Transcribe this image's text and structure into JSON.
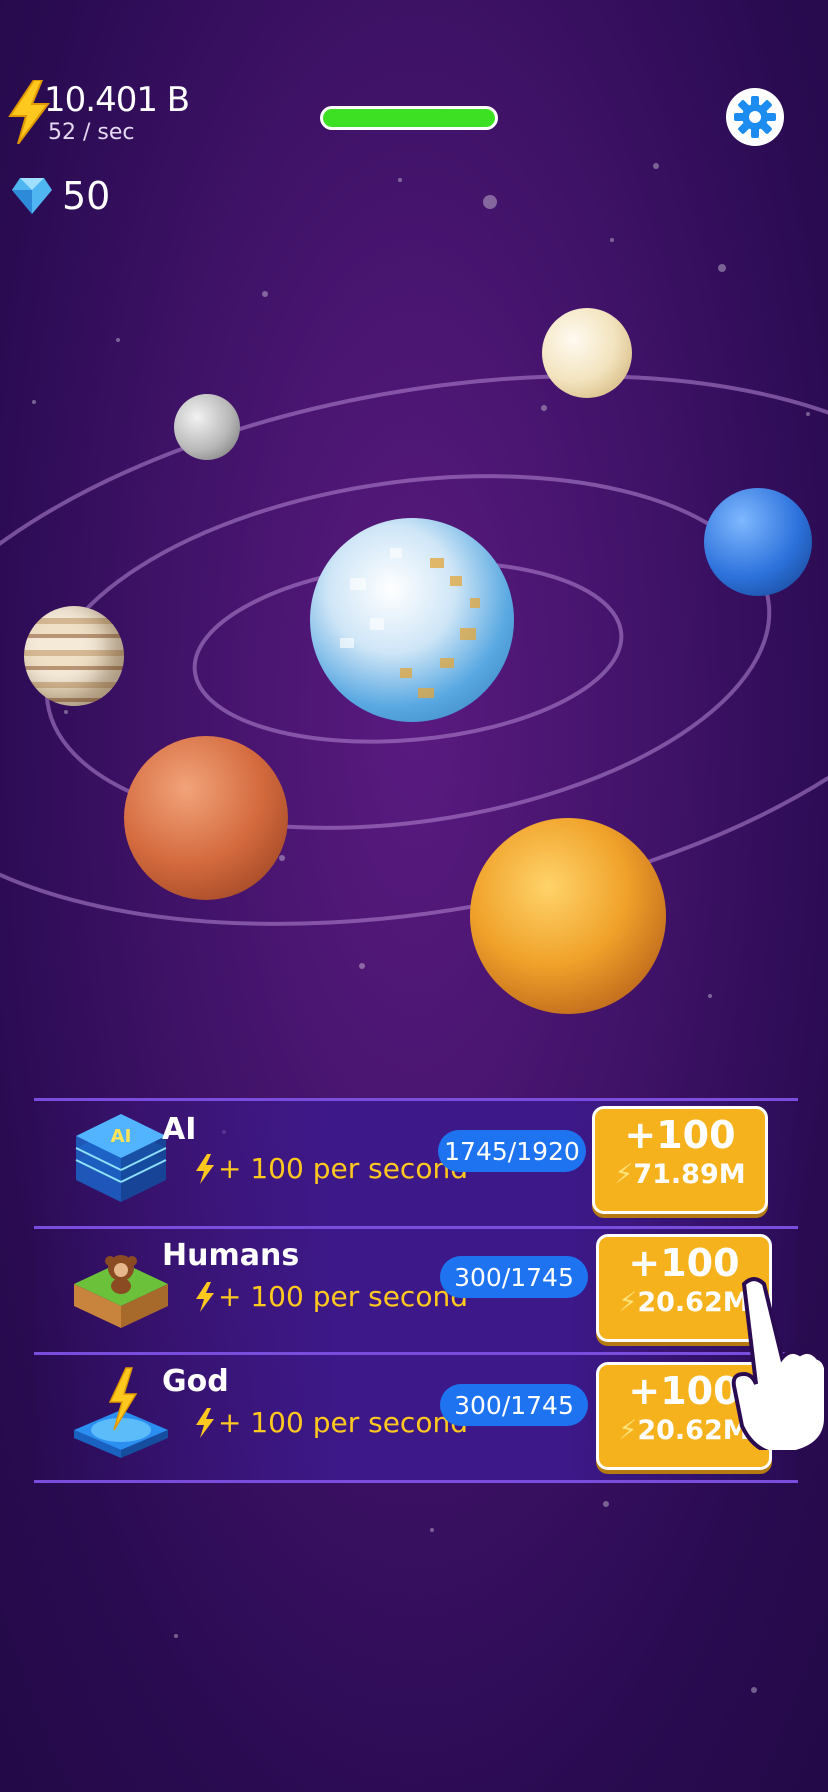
{
  "hud": {
    "energy_amount": "10.401 B",
    "energy_rate": "52 / sec",
    "gems": "50",
    "progress": 1.0
  },
  "colors": {
    "background": "#3e1266",
    "progress_fill": "#3ee024",
    "rate_text": "#ffc81e",
    "pill": "#1e74f0",
    "buy_button": "#f6b21d",
    "settings_icon": "#1d8cf0"
  },
  "upgrades": [
    {
      "title": "AI",
      "rate": "+ 100 per second",
      "progress": "1745/1920",
      "buy_label": "+100",
      "cost": "71.89M",
      "icon": "ai-chip-icon"
    },
    {
      "title": "Humans",
      "rate": "+ 100 per second",
      "progress": "300/1745",
      "buy_label": "+100",
      "cost": "20.62M",
      "icon": "monkey-island-icon"
    },
    {
      "title": "God",
      "rate": "+ 100 per second",
      "progress": "300/1745",
      "buy_label": "+100",
      "cost": "20.62M",
      "icon": "lightning-platform-icon"
    }
  ]
}
